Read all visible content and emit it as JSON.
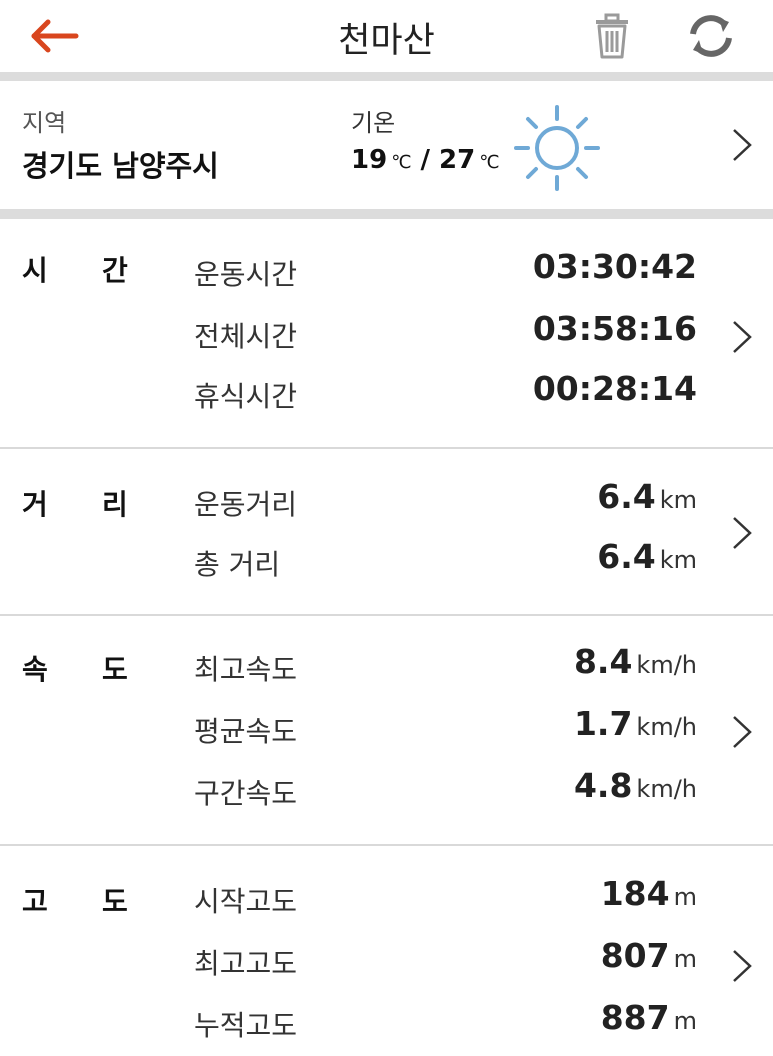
{
  "header": {
    "title": "천마산",
    "back_icon": "arrow-left-icon",
    "delete_icon": "trash-icon",
    "refresh_icon": "refresh-icon",
    "accent_color": "#d9461e"
  },
  "info": {
    "region_label": "지역",
    "region_value": "경기도 남양주시",
    "temp_label": "기온",
    "temp_low": "19",
    "temp_high": "27",
    "temp_unit": "℃",
    "temp_separator": "/",
    "weather_icon": "sun-icon",
    "sun_color": "#6fa9d6"
  },
  "sections": {
    "time": {
      "cat_1": "시",
      "cat_2": "간",
      "rows": [
        {
          "label": "운동시간",
          "value": "03:30:42",
          "unit": ""
        },
        {
          "label": "전체시간",
          "value": "03:58:16",
          "unit": ""
        },
        {
          "label": "휴식시간",
          "value": "00:28:14",
          "unit": ""
        }
      ]
    },
    "distance": {
      "cat_1": "거",
      "cat_2": "리",
      "rows": [
        {
          "label": "운동거리",
          "value": "6.4",
          "unit": "km"
        },
        {
          "label": "총 거리",
          "value": "6.4",
          "unit": "km"
        }
      ]
    },
    "speed": {
      "cat_1": "속",
      "cat_2": "도",
      "rows": [
        {
          "label": "최고속도",
          "value": "8.4",
          "unit": "km/h"
        },
        {
          "label": "평균속도",
          "value": "1.7",
          "unit": "km/h"
        },
        {
          "label": "구간속도",
          "value": "4.8",
          "unit": "km/h"
        }
      ]
    },
    "altitude": {
      "cat_1": "고",
      "cat_2": "도",
      "rows": [
        {
          "label": "시작고도",
          "value": "184",
          "unit": "m"
        },
        {
          "label": "최고고도",
          "value": "807",
          "unit": "m"
        },
        {
          "label": "누적고도",
          "value": "887",
          "unit": "m"
        }
      ]
    }
  }
}
